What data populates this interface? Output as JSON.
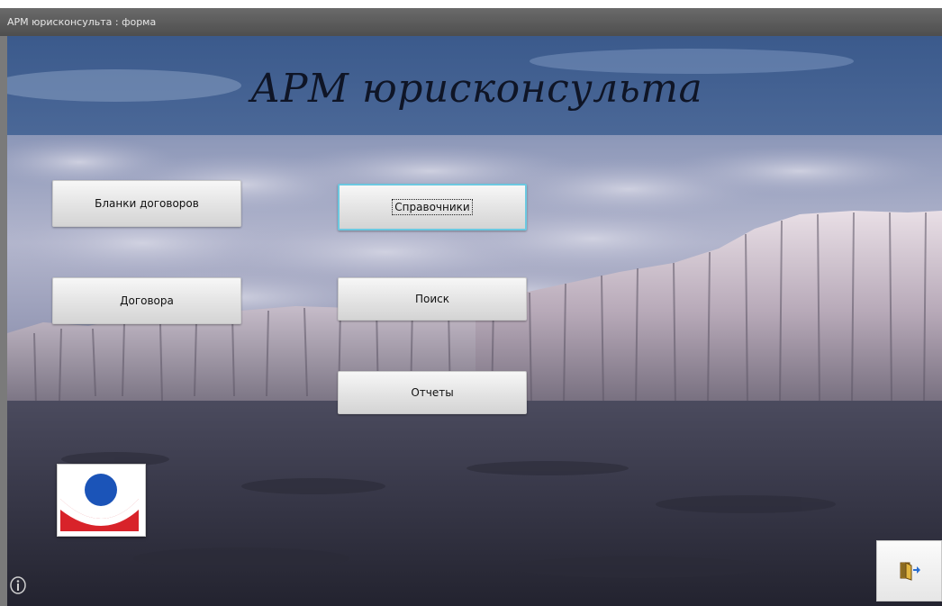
{
  "window": {
    "title": "АРМ юрисконсульта : форма"
  },
  "form": {
    "heading": "АРМ юрисконсульта",
    "buttons": {
      "contract_forms": "Бланки договоров",
      "directories": "Справочники",
      "contracts": "Договора",
      "search": "Поиск",
      "reports": "Отчеты"
    },
    "focused_button": "directories"
  },
  "icons": {
    "logo": "company-logo",
    "exit": "exit-door-icon",
    "info": "info-icon"
  },
  "colors": {
    "focus_border": "#6cc8e0",
    "logo_blue": "#1b54b8",
    "logo_red": "#d8232a"
  }
}
